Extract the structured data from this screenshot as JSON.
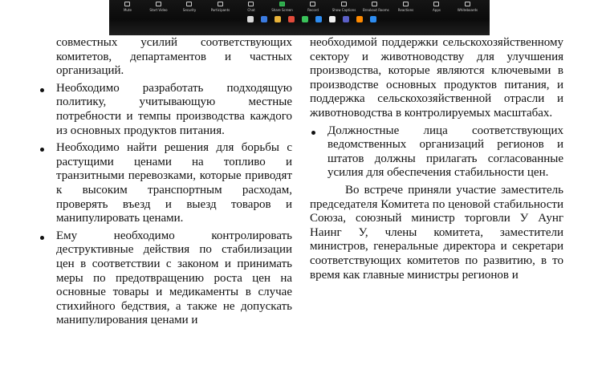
{
  "photo": {
    "toolbar": [
      {
        "label": "Mute",
        "icon": "microphone-icon"
      },
      {
        "label": "Start Video",
        "icon": "video-icon"
      },
      {
        "label": "Security",
        "icon": "shield-icon"
      },
      {
        "label": "Participants",
        "icon": "participants-icon"
      },
      {
        "label": "Chat",
        "icon": "chat-icon"
      },
      {
        "label": "Share Screen",
        "icon": "share-screen-icon"
      },
      {
        "label": "Record",
        "icon": "record-icon"
      },
      {
        "label": "Show Captions",
        "icon": "captions-icon"
      },
      {
        "label": "Breakout Rooms",
        "icon": "breakout-rooms-icon"
      },
      {
        "label": "Reactions",
        "icon": "reactions-icon"
      },
      {
        "label": "Apps",
        "icon": "apps-icon"
      },
      {
        "label": "Whiteboards",
        "icon": "whiteboard-icon"
      }
    ],
    "accent_green": "#2ea84b",
    "accent_red": "#c6392a"
  },
  "left_column": {
    "continuation": "совместных усилий соответствующих комитетов, департаментов и частных организаций.",
    "bullets": [
      "Необходимо разработать подходящую политику, учитывающую местные потребности и темпы производства каждого из основных продуктов питания.",
      "Необходимо найти решения для борьбы с растущими ценами на топливо и транзитными перевозками, которые приводят к высоким транспортным расходам, проверять въезд и выезд товаров и манипулировать ценами.",
      "Ему необходимо контролировать деструктивные действия по стабилизации цен в соответствии с законом и принимать меры по предотвращению роста цен на основные товары и медикаменты в случае стихийного бедствия, а также не допускать манипулирования ценами и"
    ]
  },
  "right_column": {
    "continuation": "необходимой поддержки сельскохозяйственному сектору и животноводству для улучшения производства, которые являются ключевыми в производстве основных продуктов питания, и поддержка сельскохозяйственной отрасли и животноводства в контролируемых масштабах.",
    "bullets": [
      "Должностные лица соответствующих ведомственных организаций регионов и штатов должны прилагать согласованные усилия для обеспечения стабильности цен."
    ],
    "paragraph": "Во встрече приняли участие заместитель председателя Комитета по ценовой стабильности Союза, союзный министр торговли У Аунг Наинг У, члены комитета, заместители министров, генеральные директора и секретари соответствующих комитетов по развитию, в то время как главные министры регионов и"
  }
}
